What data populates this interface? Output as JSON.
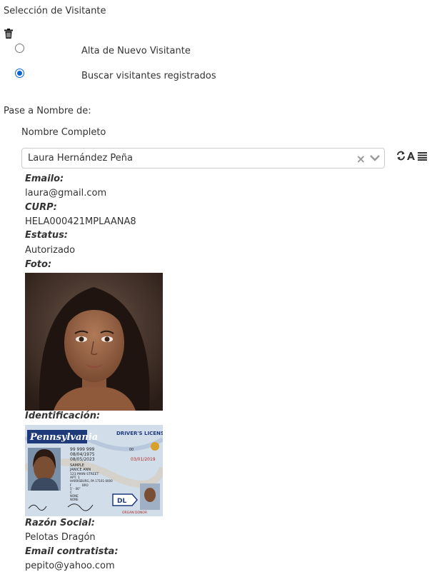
{
  "header": {
    "title": "Selección de Visitante"
  },
  "icons": {
    "delete": "trash-icon",
    "refresh": "refresh-icon",
    "font": "font-icon",
    "list": "list-icon",
    "clear": "clear-icon",
    "dropdown": "chevron-down-icon"
  },
  "options": [
    {
      "label": "Alta de Nuevo Visitante",
      "checked": false
    },
    {
      "label": "Buscar visitantes registrados",
      "checked": true
    }
  ],
  "pass": {
    "label": "Pase a Nombre de:",
    "name_label": "Nombre Completo",
    "selected_visitor": "Laura Hernández Peña"
  },
  "details": {
    "email_label": "Emailo:",
    "email": "laura@gmail.com",
    "curp_label": "CURP:",
    "curp": "HELA000421MPLAANA8",
    "status_label": "Estatus:",
    "status": "Autorizado",
    "photo_label": "Foto:",
    "id_label": "Identificación:",
    "company_label": "Razón Social:",
    "company": "Pelotas Dragón",
    "contractor_email_label": "Email contratista:",
    "contractor_email": "pepito@yahoo.com"
  },
  "id_card": {
    "state": "Pennsylvania",
    "type": "DRIVER'S LICENSE",
    "number": "99 999 999",
    "dob": "08/04/1975",
    "iss": "08/05/2023",
    "exp": "03/01/2019",
    "name1": "SAMPLE",
    "name2": "JANICE ANN",
    "address": "123 MAIN STREET",
    "apt": "APT. 1",
    "city": "HARRISBURG, PA 17101-0000",
    "class": "C",
    "sex": "F",
    "height": "5' - 06\"",
    "eyes": "BRO",
    "restrictions": "NONE",
    "endorsements": "NONE",
    "badge": "DL",
    "donor": "ORGAN DONOR",
    "dups": "00"
  },
  "colors": {
    "accent": "#0b63ce",
    "text": "#333333",
    "border": "#cccccc"
  }
}
